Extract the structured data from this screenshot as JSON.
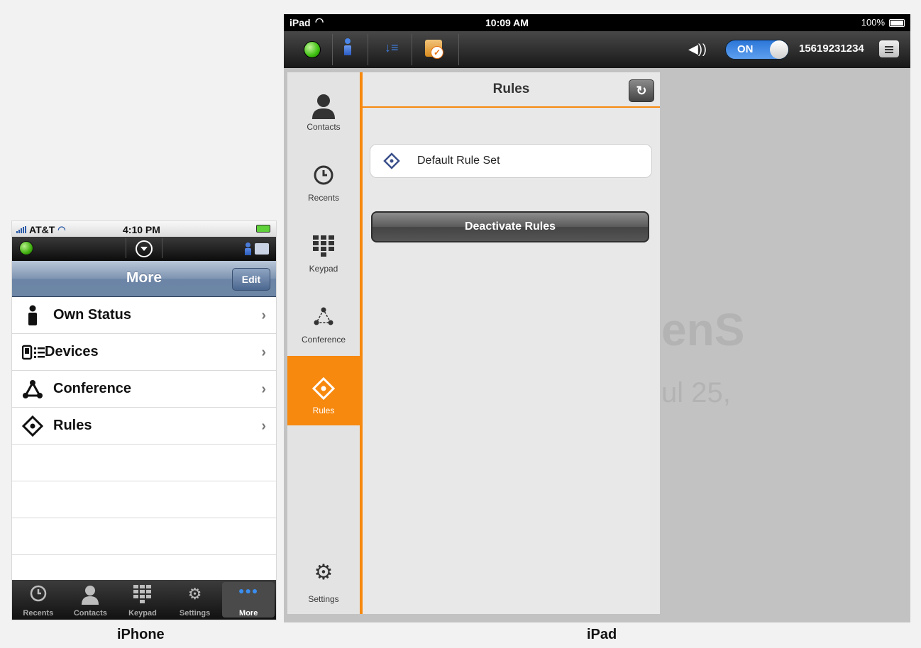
{
  "iphone": {
    "status": {
      "carrier": "AT&T",
      "time": "4:10 PM"
    },
    "navbar": {
      "title": "More",
      "edit_label": "Edit"
    },
    "rows": [
      {
        "label": "Own Status",
        "icon": "person-icon"
      },
      {
        "label": "Devices",
        "icon": "devices-icon"
      },
      {
        "label": "Conference",
        "icon": "conference-icon"
      },
      {
        "label": "Rules",
        "icon": "rules-icon"
      }
    ],
    "tabs": [
      {
        "label": "Recents",
        "icon": "clock-icon"
      },
      {
        "label": "Contacts",
        "icon": "person-icon"
      },
      {
        "label": "Keypad",
        "icon": "keypad-icon"
      },
      {
        "label": "Settings",
        "icon": "gear-icon"
      },
      {
        "label": "More",
        "icon": "more-icon",
        "active": true
      }
    ],
    "caption": "iPhone"
  },
  "ipad": {
    "status": {
      "device": "iPad",
      "time": "10:09 AM",
      "battery": "100%"
    },
    "toolbar": {
      "toggle_label": "ON",
      "phone_number": "15619231234"
    },
    "sidebar": [
      {
        "label": "Contacts",
        "icon": "person-icon"
      },
      {
        "label": "Recents",
        "icon": "clock-icon"
      },
      {
        "label": "Keypad",
        "icon": "keypad-icon"
      },
      {
        "label": "Conference",
        "icon": "conference-icon"
      },
      {
        "label": "Rules",
        "icon": "rules-icon",
        "active": true
      },
      {
        "label": "Settings",
        "icon": "gear-icon"
      }
    ],
    "panel": {
      "title": "Rules",
      "rule_set": "Default Rule Set",
      "deactivate_label": "Deactivate Rules"
    },
    "background": {
      "text1": "enS",
      "text2": "ul 25,"
    },
    "caption": "iPad"
  },
  "colors": {
    "accent": "#f7890f",
    "nav_blue": "#6d86a6",
    "status_green": "#3cbf0e"
  }
}
